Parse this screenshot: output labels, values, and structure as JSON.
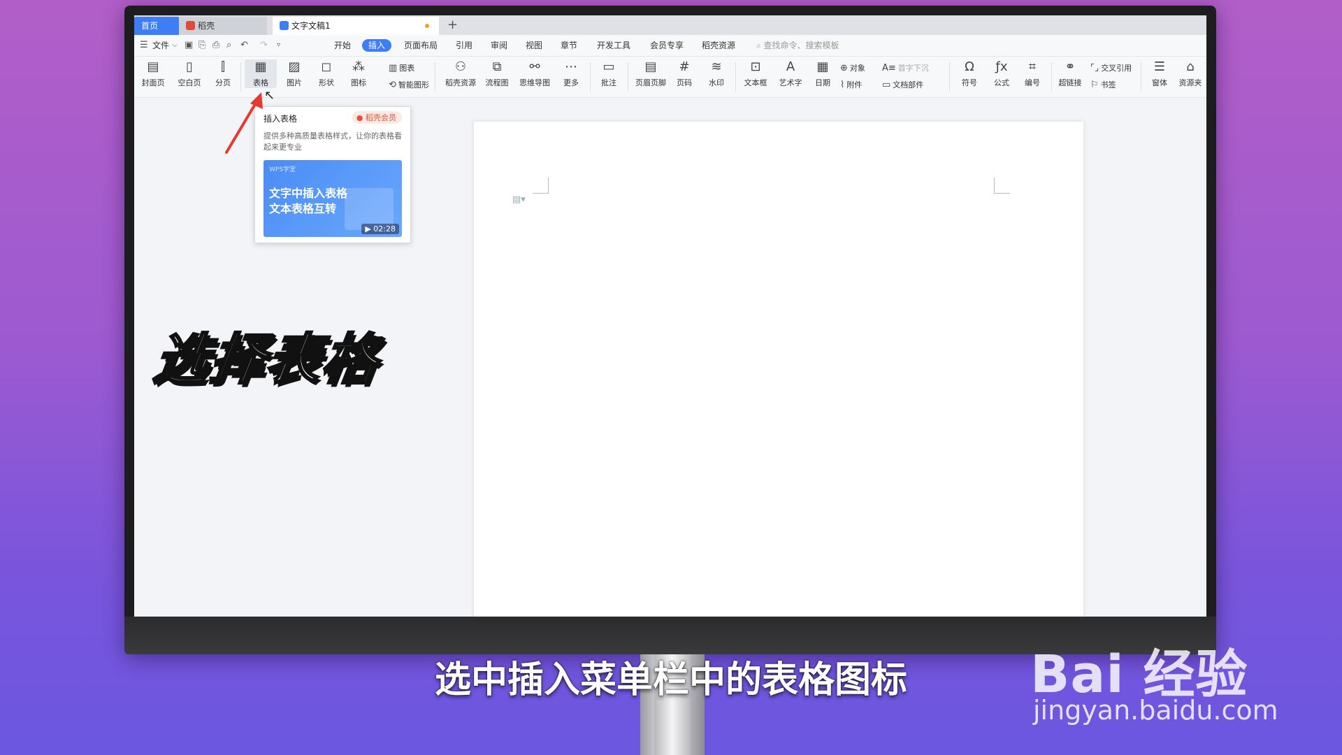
{
  "tabs": {
    "home": "首页",
    "daoke": "稻壳",
    "doc": "文字文稿1",
    "new_tab": "+"
  },
  "menu": {
    "file": "文件",
    "items": [
      "开始",
      "插入",
      "页面布局",
      "引用",
      "审阅",
      "视图",
      "章节",
      "开发工具",
      "会员专享",
      "稻壳资源"
    ],
    "active": "插入",
    "search_placeholder": "查找命令、搜索模板"
  },
  "ribbon": {
    "cover": "封面页",
    "blank": "空白页",
    "pagebreak": "分页",
    "table": "表格",
    "picture": "图片",
    "shape": "形状",
    "icon": "图标",
    "chart": "图表",
    "smartart": "智能图形",
    "daoke_res": "稻壳资源",
    "flowchart": "流程图",
    "mindmap": "思维导图",
    "more": "更多",
    "comment": "批注",
    "header_footer": "页眉页脚",
    "page_num": "页码",
    "watermark": "水印",
    "textbox": "文本框",
    "wordart": "艺术字",
    "date": "日期",
    "object": "对象",
    "attachment": "附件",
    "dropcap": "首字下沉",
    "docparts": "文档部件",
    "symbol": "符号",
    "formula": "公式",
    "numbering": "编号",
    "hyperlink": "超链接",
    "crossref": "交叉引用",
    "bookmark": "书签",
    "form": "窗体",
    "resource": "资源夹"
  },
  "popup": {
    "title": "插入表格",
    "badge": "稻壳会员",
    "desc": "提供多种高质量表格样式，让你的表格看起来更专业",
    "video_tag": "WPS学堂",
    "video_line1": "文字中插入表格",
    "video_line2": "文本表格互转",
    "video_duration": "02:28"
  },
  "overlay": {
    "big": "选择表格",
    "subtitle": "选中插入菜单栏中的表格图标",
    "watermark": "Bai 经验",
    "watermark_url": "jingyan.baidu.com"
  }
}
